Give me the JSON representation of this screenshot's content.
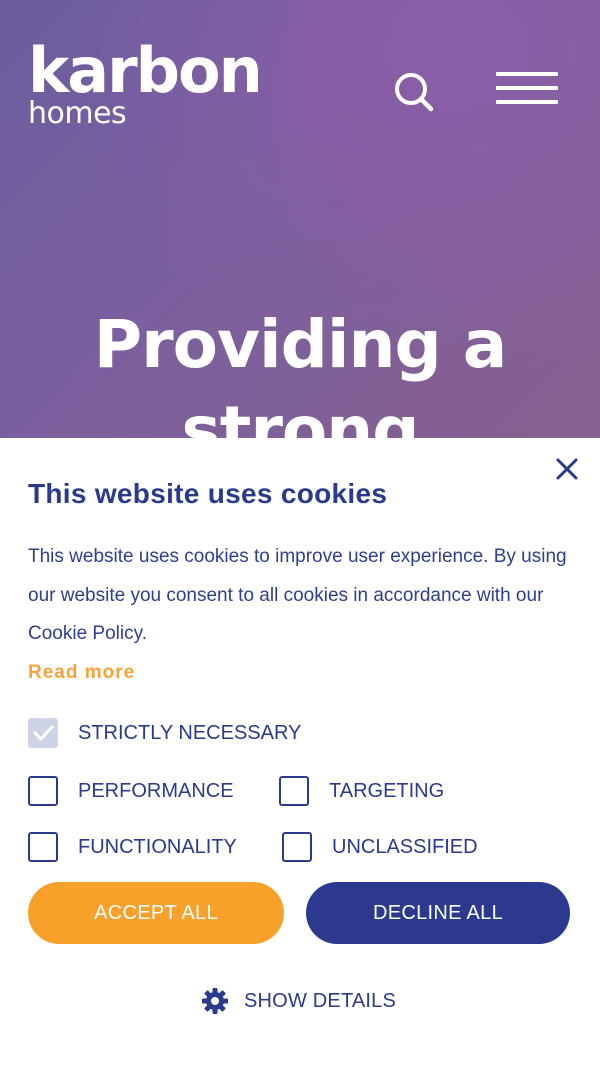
{
  "header": {
    "logo_main": "karbon",
    "logo_sub": "homes",
    "search_icon": "search-icon",
    "menu_icon": "hamburger-menu-icon"
  },
  "hero": {
    "title_line1": "Providing a",
    "title_line2": "strong"
  },
  "cookie_banner": {
    "title": "This website uses cookies",
    "body": "This website uses cookies to improve user experience. By using our website you consent to all cookies in accordance with our Cookie Policy.",
    "read_more": "Read more",
    "close_icon": "close-icon",
    "categories": [
      {
        "label": "STRICTLY NECESSARY",
        "checked": true,
        "disabled": true
      },
      {
        "label": "PERFORMANCE",
        "checked": false
      },
      {
        "label": "TARGETING",
        "checked": false
      },
      {
        "label": "FUNCTIONALITY",
        "checked": false
      },
      {
        "label": "UNCLASSIFIED",
        "checked": false
      }
    ],
    "accept_label": "ACCEPT ALL",
    "decline_label": "DECLINE ALL",
    "show_details_label": "SHOW DETAILS",
    "show_details_icon": "gear-icon"
  },
  "colors": {
    "brand_navy": "#2a3a8c",
    "accent_orange": "#f7a12a",
    "hero_purple": "#7a5f9f"
  }
}
